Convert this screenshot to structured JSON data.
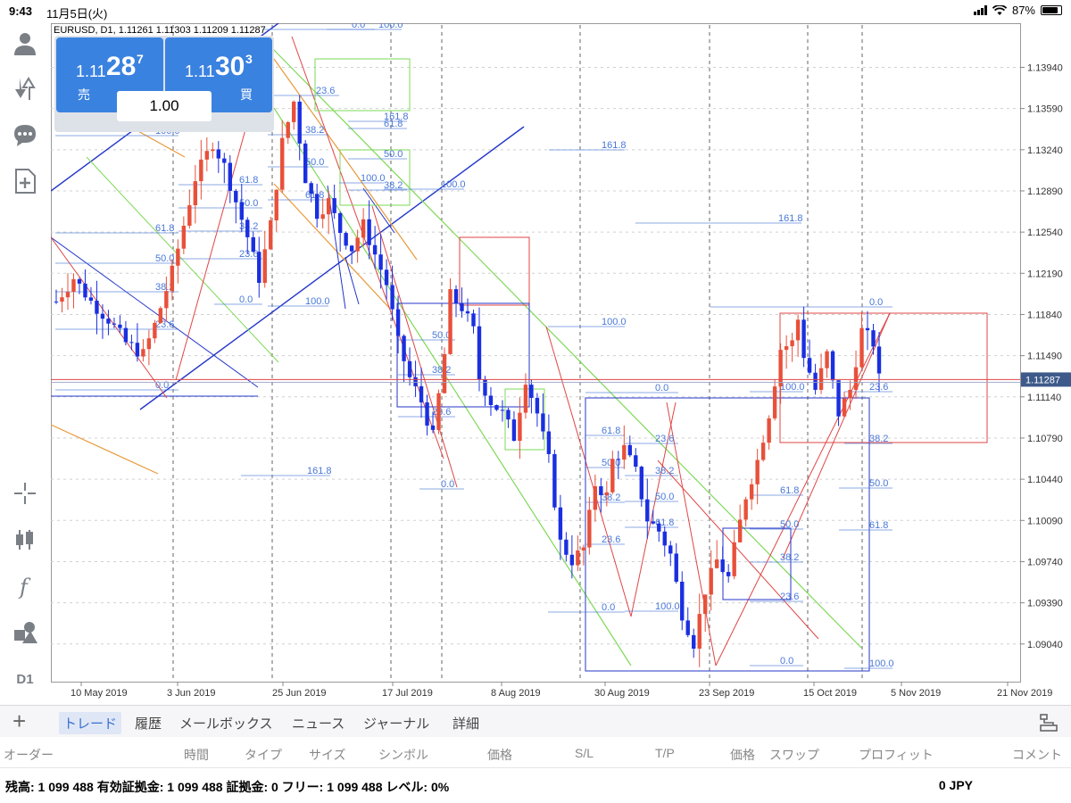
{
  "status": {
    "time": "9:43",
    "date": "11月5日(火)",
    "battery": "87%",
    "battery_level": 0.87
  },
  "chart_info": {
    "header": "EURUSD, D1, 1.11261 1.11303 1.11209 1.11287"
  },
  "trade": {
    "sell_prefix": "1.11",
    "sell_big": "28",
    "sell_sup": "7",
    "sell_label": "売",
    "buy_prefix": "1.11",
    "buy_big": "30",
    "buy_sup": "3",
    "buy_label": "買",
    "lot": "1.00"
  },
  "sidebar": {
    "timeframe": "D1"
  },
  "chart_data": {
    "type": "candlestick",
    "symbol": "EURUSD",
    "timeframe": "D1",
    "current_price": 1.11287,
    "current_price_label": "1.11287",
    "ylim": [
      1.0872,
      1.143
    ],
    "y_ticks": [
      "1.13940",
      "1.13590",
      "1.13240",
      "1.12890",
      "1.12540",
      "1.12190",
      "1.11840",
      "1.11490",
      "1.11140",
      "1.10790",
      "1.10440",
      "1.10090",
      "1.09740",
      "1.09390",
      "1.09040"
    ],
    "x_ticks": [
      "10 May 2019",
      "3 Jun 2019",
      "25 Jun 2019",
      "17 Jul 2019",
      "8 Aug 2019",
      "30 Aug 2019",
      "23 Sep 2019",
      "15 Oct 2019",
      "5 Nov 2019",
      "21 Nov 2019"
    ],
    "path": [
      [
        0,
        1.1195
      ],
      [
        3,
        1.1215
      ],
      [
        6,
        1.1195
      ],
      [
        9,
        1.118
      ],
      [
        12,
        1.116
      ],
      [
        15,
        1.115
      ],
      [
        17,
        1.1175
      ],
      [
        20,
        1.122
      ],
      [
        22,
        1.126
      ],
      [
        24,
        1.13
      ],
      [
        27,
        1.133
      ],
      [
        29,
        1.131
      ],
      [
        31,
        1.128
      ],
      [
        33,
        1.125
      ],
      [
        35,
        1.1215
      ],
      [
        37,
        1.126
      ],
      [
        39,
        1.133
      ],
      [
        41,
        1.1365
      ],
      [
        43,
        1.13
      ],
      [
        45,
        1.127
      ],
      [
        47,
        1.128
      ],
      [
        49,
        1.1255
      ],
      [
        51,
        1.124
      ],
      [
        53,
        1.126
      ],
      [
        55,
        1.1235
      ],
      [
        57,
        1.121
      ],
      [
        59,
        1.116
      ],
      [
        61,
        1.113
      ],
      [
        63,
        1.111
      ],
      [
        65,
        1.108
      ],
      [
        67,
        1.115
      ],
      [
        68,
        1.12
      ],
      [
        70,
        1.119
      ],
      [
        72,
        1.117
      ],
      [
        73,
        1.113
      ],
      [
        75,
        1.111
      ],
      [
        77,
        1.11
      ],
      [
        79,
        1.108
      ],
      [
        81,
        1.113
      ],
      [
        83,
        1.11
      ],
      [
        85,
        1.106
      ],
      [
        87,
        1.099
      ],
      [
        89,
        1.0975
      ],
      [
        91,
        1.0985
      ],
      [
        93,
        1.104
      ],
      [
        95,
        1.103
      ],
      [
        96,
        1.106
      ],
      [
        98,
        1.107
      ],
      [
        100,
        1.105
      ],
      [
        102,
        1.101
      ],
      [
        104,
        1.1
      ],
      [
        106,
        1.098
      ],
      [
        108,
        1.093
      ],
      [
        110,
        1.0905
      ],
      [
        112,
        1.095
      ],
      [
        114,
        1.0975
      ],
      [
        116,
        1.096
      ],
      [
        117,
        1.0985
      ],
      [
        119,
        1.103
      ],
      [
        121,
        1.106
      ],
      [
        123,
        1.11
      ],
      [
        125,
        1.1155
      ],
      [
        127,
        1.116
      ],
      [
        128,
        1.118
      ],
      [
        129,
        1.115
      ],
      [
        131,
        1.112
      ],
      [
        133,
        1.115
      ],
      [
        135,
        1.11
      ],
      [
        137,
        1.112
      ],
      [
        139,
        1.117
      ],
      [
        141,
        1.116
      ],
      [
        142,
        1.1129
      ]
    ],
    "levels": [
      {
        "label": "0.0",
        "x0": 294,
        "x1": 420,
        "y": 33,
        "color": "#4a78d8"
      },
      {
        "label": "100.0",
        "x0": 366,
        "x1": 450,
        "y": 33,
        "color": "#4a78d8"
      },
      {
        "label": "23.6",
        "x0": 300,
        "x1": 380,
        "y": 107,
        "color": "#4a78d8"
      },
      {
        "label": "161.8",
        "x0": 390,
        "x1": 456,
        "y": 136,
        "color": "#4a78d8"
      },
      {
        "label": "61.8",
        "x0": 390,
        "x1": 456,
        "y": 144,
        "color": "#4a78d8"
      },
      {
        "label": "100.0",
        "x0": 62,
        "x1": 200,
        "y": 152,
        "color": "#4a78d8"
      },
      {
        "label": "38.2",
        "x0": 300,
        "x1": 368,
        "y": 151,
        "color": "#4a78d8"
      },
      {
        "label": "161.8",
        "x0": 615,
        "x1": 700,
        "y": 168,
        "color": "#4a78d8"
      },
      {
        "label": "50.0",
        "x0": 390,
        "x1": 456,
        "y": 178,
        "color": "#4a78d8"
      },
      {
        "label": "50.0",
        "x0": 300,
        "x1": 368,
        "y": 187,
        "color": "#4a78d8"
      },
      {
        "label": "61.8",
        "x0": 200,
        "x1": 294,
        "y": 207,
        "color": "#4a78d8"
      },
      {
        "label": "100.0",
        "x0": 380,
        "x1": 430,
        "y": 205,
        "color": "#4a78d8"
      },
      {
        "label": "38.2",
        "x0": 390,
        "x1": 456,
        "y": 213,
        "color": "#4a78d8"
      },
      {
        "label": "100.0",
        "x0": 430,
        "x1": 520,
        "y": 212,
        "color": "#4a78d8"
      },
      {
        "label": "61.8",
        "x0": 300,
        "x1": 368,
        "y": 224,
        "color": "#4a78d8"
      },
      {
        "label": "50.0",
        "x0": 200,
        "x1": 294,
        "y": 233,
        "color": "#4a78d8"
      },
      {
        "label": "161.8",
        "x0": 712,
        "x1": 898,
        "y": 250,
        "color": "#4a78d8"
      },
      {
        "label": "38.2",
        "x0": 200,
        "x1": 294,
        "y": 259,
        "color": "#4a78d8"
      },
      {
        "label": "61.8",
        "x0": 62,
        "x1": 200,
        "y": 261,
        "color": "#4a78d8"
      },
      {
        "label": "23.6",
        "x0": 200,
        "x1": 294,
        "y": 290,
        "color": "#4a78d8"
      },
      {
        "label": "50.0",
        "x0": 62,
        "x1": 200,
        "y": 295,
        "color": "#4a78d8"
      },
      {
        "label": "38.2",
        "x0": 62,
        "x1": 200,
        "y": 327,
        "color": "#4a78d8"
      },
      {
        "label": "0.0",
        "x0": 240,
        "x1": 294,
        "y": 341,
        "color": "#4a78d8"
      },
      {
        "label": "100.0",
        "x0": 300,
        "x1": 368,
        "y": 343,
        "color": "#4a78d8"
      },
      {
        "label": "0.0",
        "x0": 796,
        "x1": 1000,
        "y": 344,
        "color": "#4a78d8"
      },
      {
        "label": "100.0",
        "x0": 614,
        "x1": 700,
        "y": 366,
        "color": "#4a78d8"
      },
      {
        "label": "23.6",
        "x0": 62,
        "x1": 200,
        "y": 369,
        "color": "#4a78d8"
      },
      {
        "label": "50.0",
        "x0": 446,
        "x1": 510,
        "y": 381,
        "color": "#4a78d8"
      },
      {
        "label": "38.2",
        "x0": 446,
        "x1": 510,
        "y": 420,
        "color": "#4a78d8"
      },
      {
        "label": "0.0",
        "x0": 62,
        "x1": 200,
        "y": 437,
        "color": "#4a78d8"
      },
      {
        "label": "0.0",
        "x0": 656,
        "x1": 760,
        "y": 440,
        "color": "#4a78d8"
      },
      {
        "label": "100.0",
        "x0": 840,
        "x1": 900,
        "y": 439,
        "color": "#4a78d8"
      },
      {
        "label": "23.6",
        "x0": 946,
        "x1": 1000,
        "y": 439,
        "color": "#4a78d8"
      },
      {
        "label": "23.6",
        "x0": 446,
        "x1": 510,
        "y": 467,
        "color": "#4a78d8"
      },
      {
        "label": "61.8",
        "x0": 656,
        "x1": 700,
        "y": 488,
        "color": "#4a78d8"
      },
      {
        "label": "23.6",
        "x0": 700,
        "x1": 760,
        "y": 497,
        "color": "#4a78d8"
      },
      {
        "label": "38.2",
        "x0": 946,
        "x1": 1000,
        "y": 497,
        "color": "#4a78d8"
      },
      {
        "label": "50.0",
        "x0": 656,
        "x1": 700,
        "y": 524,
        "color": "#4a78d8"
      },
      {
        "label": "161.8",
        "x0": 270,
        "x1": 370,
        "y": 533,
        "color": "#4a78d8"
      },
      {
        "label": "38.2",
        "x0": 700,
        "x1": 760,
        "y": 533,
        "color": "#4a78d8"
      },
      {
        "label": "0.0",
        "x0": 470,
        "x1": 520,
        "y": 548,
        "color": "#4a78d8"
      },
      {
        "label": "50.0",
        "x0": 940,
        "x1": 1000,
        "y": 547,
        "color": "#4a78d8"
      },
      {
        "label": "61.8",
        "x0": 840,
        "x1": 900,
        "y": 555,
        "color": "#4a78d8"
      },
      {
        "label": "38.2",
        "x0": 656,
        "x1": 700,
        "y": 563,
        "color": "#4a78d8"
      },
      {
        "label": "50.0",
        "x0": 700,
        "x1": 760,
        "y": 562,
        "color": "#4a78d8"
      },
      {
        "label": "61.8",
        "x0": 700,
        "x1": 760,
        "y": 591,
        "color": "#4a78d8"
      },
      {
        "label": "50.0",
        "x0": 840,
        "x1": 900,
        "y": 593,
        "color": "#4a78d8"
      },
      {
        "label": "61.8",
        "x0": 940,
        "x1": 1000,
        "y": 594,
        "color": "#4a78d8"
      },
      {
        "label": "23.6",
        "x0": 656,
        "x1": 700,
        "y": 610,
        "color": "#4a78d8"
      },
      {
        "label": "38.2",
        "x0": 840,
        "x1": 900,
        "y": 630,
        "color": "#4a78d8"
      },
      {
        "label": "23.6",
        "x0": 840,
        "x1": 900,
        "y": 674,
        "color": "#4a78d8"
      },
      {
        "label": "0.0",
        "x0": 614,
        "x1": 700,
        "y": 686,
        "color": "#4a78d8"
      },
      {
        "label": "100.0",
        "x0": 700,
        "x1": 760,
        "y": 685,
        "color": "#4a78d8"
      },
      {
        "label": "0.0",
        "x0": 840,
        "x1": 900,
        "y": 746,
        "color": "#4a78d8"
      },
      {
        "label": "100.0",
        "x0": 946,
        "x1": 1000,
        "y": 749,
        "color": "#4a78d8"
      }
    ]
  },
  "tabs": [
    {
      "label": "トレード",
      "active": true
    },
    {
      "label": "履歴",
      "active": false
    },
    {
      "label": "メールボックス",
      "active": false
    },
    {
      "label": "ニュース",
      "active": false
    },
    {
      "label": "ジャーナル",
      "active": false
    },
    {
      "label": "詳細",
      "active": false
    }
  ],
  "columns": [
    "オーダー",
    "時間",
    "タイプ",
    "サイズ",
    "シンボル",
    "価格",
    "S/L",
    "T/P",
    "価格",
    "スワップ",
    "プロフィット",
    "コメント"
  ],
  "account": {
    "summary": "残高: 1 099 488 有効証拠金: 1 099 488 証拠金: 0 フリー: 1 099 488 レベル: 0%",
    "profit": "0  JPY"
  }
}
